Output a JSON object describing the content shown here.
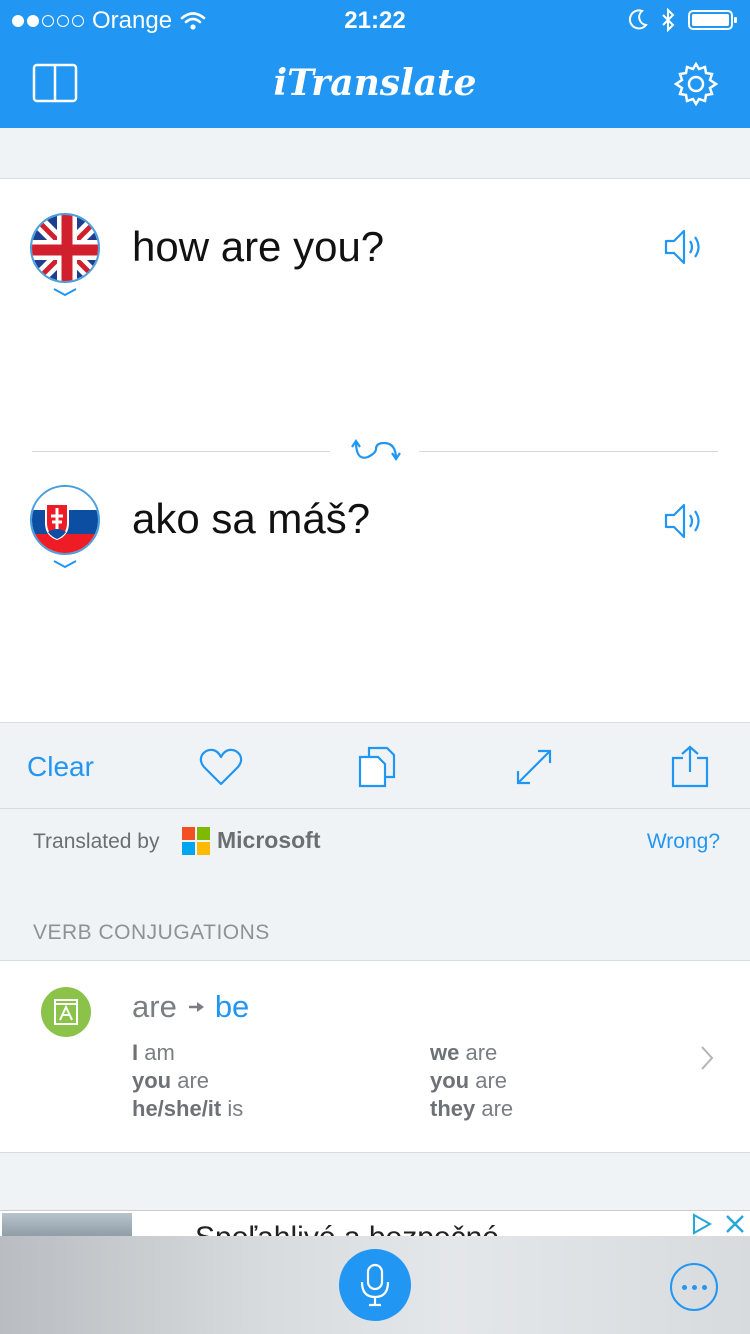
{
  "status_bar": {
    "carrier": "Orange",
    "time": "21:22"
  },
  "nav": {
    "title": "iTranslate",
    "left_icon": "book-icon",
    "right_icon": "gear-icon"
  },
  "source": {
    "text": "how are you?",
    "flag": "uk-flag"
  },
  "target": {
    "text": "ako sa máš?",
    "flag": "slovakia-flag"
  },
  "actions": {
    "clear_label": "Clear",
    "icons": [
      "heart-icon",
      "copy-icon",
      "expand-icon",
      "share-icon"
    ]
  },
  "credit": {
    "prefix": "Translated by",
    "brand": "Microsoft",
    "wrong_label": "Wrong?"
  },
  "conjugations": {
    "header": "VERB CONJUGATIONS",
    "word": "are",
    "base": "be",
    "left": [
      {
        "pronoun": "I",
        "verb": "am"
      },
      {
        "pronoun": "you",
        "verb": "are"
      },
      {
        "pronoun": "he/she/it",
        "verb": "is"
      }
    ],
    "right": [
      {
        "pronoun": "we",
        "verb": "are"
      },
      {
        "pronoun": "you",
        "verb": "are"
      },
      {
        "pronoun": "they",
        "verb": "are"
      }
    ]
  },
  "ad": {
    "text": "Spoľahlivé a bezpečné"
  },
  "colors": {
    "accent": "#2196f3",
    "badge_green": "#8bc34a",
    "ms_red": "#f25022",
    "ms_green": "#7fba00",
    "ms_blue": "#00a4ef",
    "ms_yellow": "#ffb900"
  }
}
